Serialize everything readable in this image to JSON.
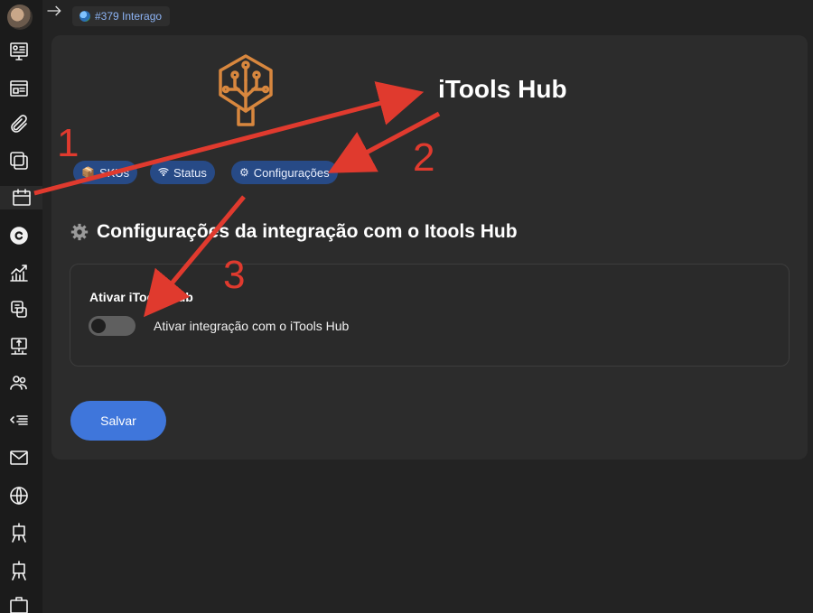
{
  "tab": {
    "label": "#379 Interago",
    "icon": "globe-icon"
  },
  "brand": {
    "name": "iTools Hub",
    "logo": "tree-logo",
    "accent": "#d8873e"
  },
  "nav_pills": [
    {
      "label": "SKUs",
      "icon": "box-icon"
    },
    {
      "label": "Status",
      "icon": "wifi-icon"
    },
    {
      "label": "Configurações",
      "icon": "gear-icon"
    }
  ],
  "section": {
    "title": "Configurações da integração com o Itools Hub",
    "icon": "gear-icon"
  },
  "setting": {
    "label": "Ativar iTools Hub",
    "toggle_text": "Ativar integração com o iTools Hub",
    "enabled": false
  },
  "save_label": "Salvar",
  "annotations": [
    "1",
    "2",
    "3"
  ],
  "colors": {
    "pill_bg": "#274a86",
    "save_bg": "#3f76db",
    "annotation": "#e03a2e"
  }
}
